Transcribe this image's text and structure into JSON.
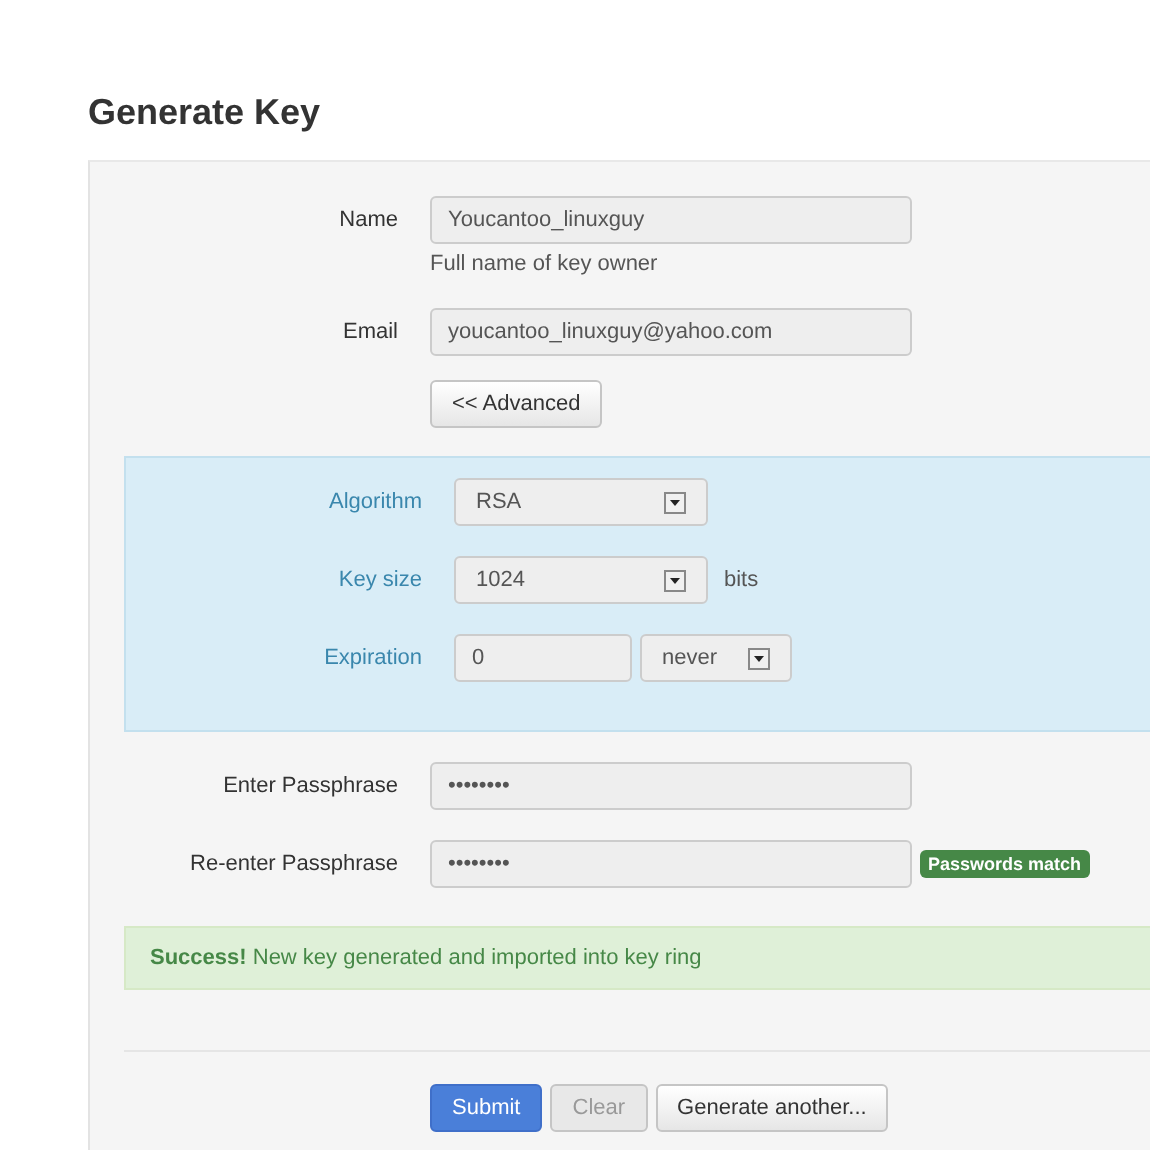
{
  "title": "Generate Key",
  "fields": [
    {
      "label": "Name",
      "value": "Youcantoo_linuxguy",
      "hint": "Full name of key owner"
    },
    {
      "label": "Email",
      "value": "youcantoo_linuxguy@yahoo.com"
    }
  ],
  "advanced_button": "<< Advanced",
  "advanced": {
    "algorithm": {
      "label": "Algorithm",
      "value": "RSA"
    },
    "key_size": {
      "label": "Key size",
      "value": "1024",
      "unit": "bits"
    },
    "expiration": {
      "label": "Expiration",
      "value": "0",
      "unit": "never"
    }
  },
  "passphrases": [
    {
      "label": "Enter Passphrase",
      "value": "••••••••"
    },
    {
      "label": "Re-enter Passphrase",
      "value": "••••••••",
      "badge": "Passwords match"
    }
  ],
  "alert": "**Success!** New key generated and imported into key ring",
  "buttons": [
    {
      "label": "Submit",
      "kind": "primary",
      "disabled": false
    },
    {
      "label": "Clear",
      "kind": "default",
      "disabled": true
    },
    {
      "label": "Generate another...",
      "kind": "default",
      "disabled": false
    }
  ]
}
